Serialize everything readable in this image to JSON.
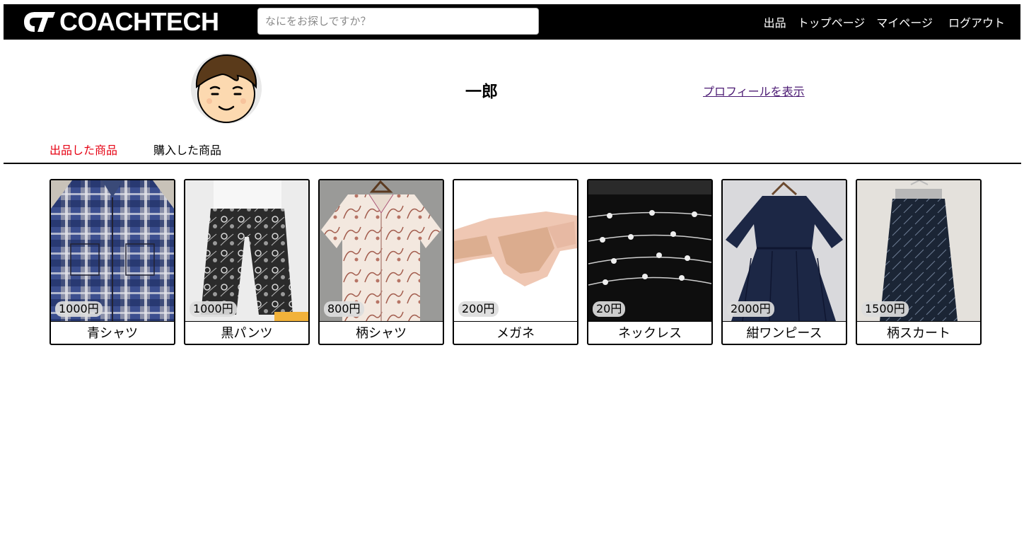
{
  "header": {
    "logo_text": "COACHTECH",
    "search_placeholder": "なにをお探しですか？",
    "nav": {
      "sell": "出品",
      "top": "トップページ",
      "mypage": "マイページ",
      "logout": "ログアウト"
    }
  },
  "profile": {
    "name": "一郎",
    "view_profile": "プロフィールを表示"
  },
  "tabs": {
    "sold": "出品した商品",
    "bought": "購入した商品"
  },
  "items": [
    {
      "name": "青シャツ",
      "price": "1000円",
      "icon": "plaid-shirt-photo"
    },
    {
      "name": "黒パンツ",
      "price": "1000円",
      "icon": "patterned-pants-photo"
    },
    {
      "name": "柄シャツ",
      "price": "800円",
      "icon": "patterned-shirt-photo"
    },
    {
      "name": "メガネ",
      "price": "200円",
      "icon": "sunglasses-photo"
    },
    {
      "name": "ネックレス",
      "price": "20円",
      "icon": "pearl-necklace-photo"
    },
    {
      "name": "紺ワンピース",
      "price": "2000円",
      "icon": "navy-dress-photo"
    },
    {
      "name": "柄スカート",
      "price": "1500円",
      "icon": "patterned-skirt-photo"
    }
  ],
  "colors": {
    "header_bg": "#000000",
    "active_tab": "#e60012",
    "link": "#4b1a73"
  }
}
